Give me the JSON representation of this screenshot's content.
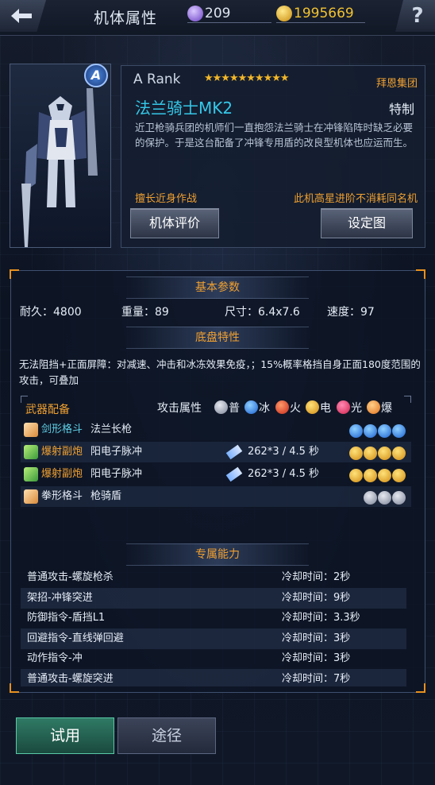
{
  "header": {
    "title": "机体属性",
    "crystal_value": "209",
    "gold_value": "1995669",
    "help_label": "?"
  },
  "mech": {
    "rank_badge": "A",
    "rank": "A  Rank",
    "stars": "★★★★★★★★★★",
    "star_count": 10,
    "corporation": "拜恩集团",
    "name": "法兰骑士MK2",
    "type": "特制",
    "description": "近卫枪骑兵团的机师们一直抱怨法兰骑士在冲锋陷阵时缺乏必要的保护。于是这台配备了冲锋专用盾的改良型机体也应运而生。",
    "tag_left": "擅长近身作战",
    "tag_right": "此机高星进阶不消耗同名机",
    "eval_button": "机体评价",
    "design_button": "设定图"
  },
  "basic": {
    "heading": "基本参数",
    "durability": "耐久：4800",
    "weight": "重量：89",
    "size": "尺寸：6.4x7.6",
    "speed": "速度：97"
  },
  "chassis": {
    "heading": "底盘特性",
    "text": "无法阻挡+正面屏障：对减速、冲击和冰冻效果免疫，；15%概率格挡自身正面180度范围的攻击，可叠加"
  },
  "weapons": {
    "heading": "武器配备",
    "attr_label": "攻击属性",
    "attributes": [
      {
        "label": "普",
        "icon": "normal-orb"
      },
      {
        "label": "冰",
        "icon": "ice-orb"
      },
      {
        "label": "火",
        "icon": "fire-orb"
      },
      {
        "label": "电",
        "icon": "electric-orb"
      },
      {
        "label": "光",
        "icon": "light-orb"
      },
      {
        "label": "爆",
        "icon": "explosive-orb"
      }
    ],
    "rows": [
      {
        "type": "剑形格斗",
        "type_color": "#5fd0e6",
        "name": "法兰长枪",
        "damage": "",
        "orbs": 4,
        "orb_type": "ice"
      },
      {
        "type": "爆射副炮",
        "type_color": "#f0a030",
        "name": "阳电子脉冲",
        "damage": "262*3  / 4.5 秒",
        "orbs": 4,
        "orb_type": "electric"
      },
      {
        "type": "爆射副炮",
        "type_color": "#f0a030",
        "name": "阳电子脉冲",
        "damage": "262*3  / 4.5 秒",
        "orbs": 4,
        "orb_type": "electric"
      },
      {
        "type": "拳形格斗",
        "type_color": "#e6edf7",
        "name": "枪骑盾",
        "damage": "",
        "orbs": 3,
        "orb_type": "normal"
      }
    ]
  },
  "abilities": {
    "heading": "专属能力",
    "rows": [
      {
        "name": "普通攻击-螺旋枪杀",
        "cooldown": "冷却时间：2秒"
      },
      {
        "name": "架招-冲锋突进",
        "cooldown": "冷却时间：9秒"
      },
      {
        "name": "防御指令-盾挡L1",
        "cooldown": "冷却时间：3.3秒"
      },
      {
        "name": "回避指令-直线弹回避",
        "cooldown": "冷却时间：3秒"
      },
      {
        "name": "动作指令-冲",
        "cooldown": "冷却时间：3秒"
      },
      {
        "name": "普通攻击-螺旋突进",
        "cooldown": "冷却时间：7秒"
      }
    ]
  },
  "footer": {
    "try_button": "试用",
    "route_button": "途径"
  },
  "colors": {
    "accent_orange": "#f0a030",
    "name_cyan": "#35c8e8",
    "try_green": "#2f7a64"
  }
}
